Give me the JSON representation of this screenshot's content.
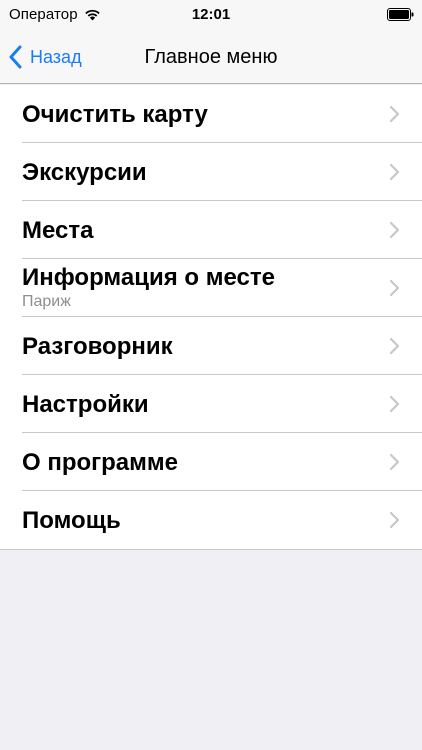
{
  "status_bar": {
    "carrier": "Оператор",
    "time": "12:01",
    "icons": [
      "wifi-icon",
      "battery-icon"
    ]
  },
  "nav": {
    "back_label": "Назад",
    "title": "Главное меню",
    "accent_color": "#1a7cf6"
  },
  "menu": {
    "items": [
      {
        "label": "Очистить карту"
      },
      {
        "label": "Экскурсии"
      },
      {
        "label": "Места"
      },
      {
        "label": "Информация о месте",
        "subtitle": "Париж"
      },
      {
        "label": "Разговорник"
      },
      {
        "label": "Настройки"
      },
      {
        "label": "О программе"
      },
      {
        "label": "Помощь"
      }
    ],
    "chevron_icon": "chevron-right-icon"
  }
}
